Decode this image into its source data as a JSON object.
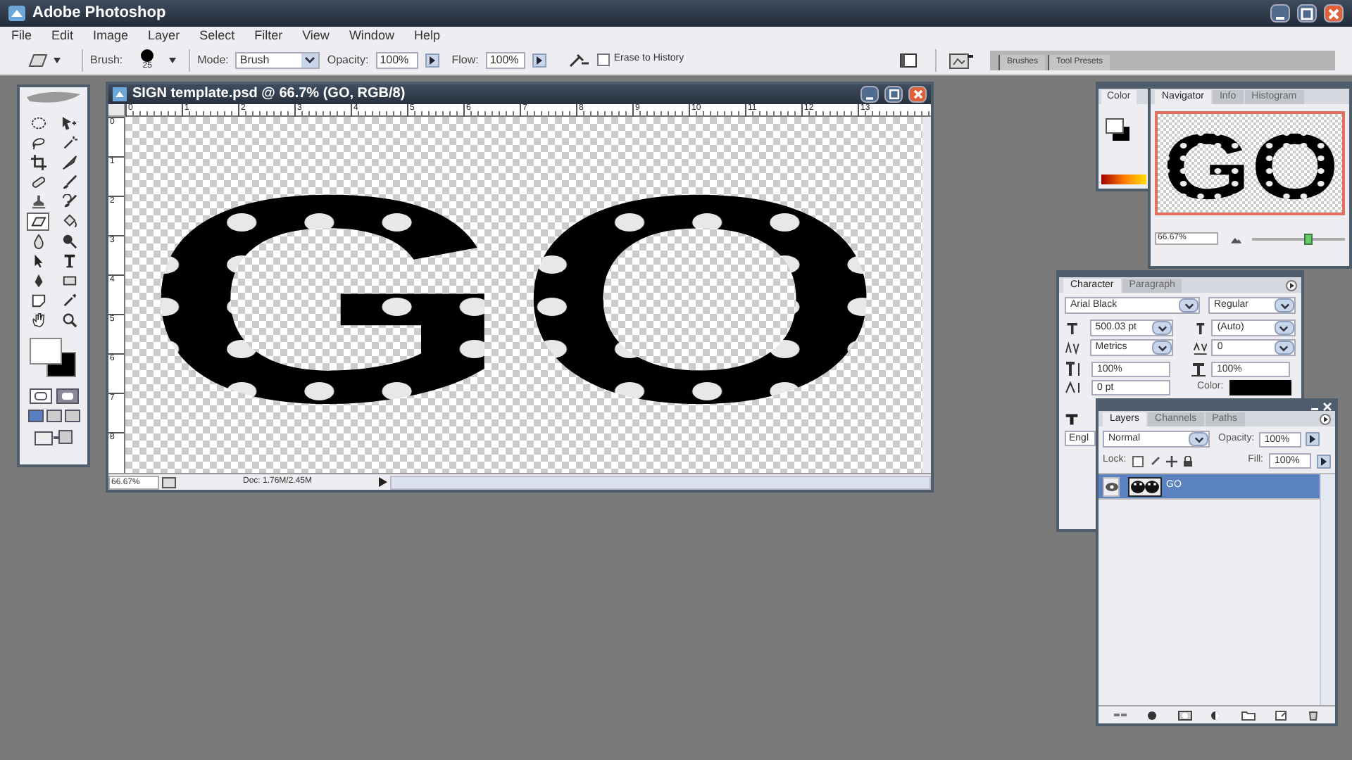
{
  "app_title": "Adobe Photoshop",
  "menu": [
    "File",
    "Edit",
    "Image",
    "Layer",
    "Select",
    "Filter",
    "View",
    "Window",
    "Help"
  ],
  "options_bar": {
    "brush_label": "Brush:",
    "brush_size": "25",
    "mode_label": "Mode:",
    "mode_value": "Brush",
    "opacity_label": "Opacity:",
    "opacity_value": "100%",
    "flow_label": "Flow:",
    "flow_value": "100%",
    "erase_to_history": {
      "label": "Erase to History",
      "checked": false
    },
    "palette_tabs": [
      "Brushes",
      "Tool Presets"
    ]
  },
  "tools": [
    {
      "kind": "marquee",
      "selected": false
    },
    {
      "kind": "move",
      "selected": false
    },
    {
      "kind": "lasso",
      "selected": false
    },
    {
      "kind": "wand",
      "selected": false
    },
    {
      "kind": "crop",
      "selected": false
    },
    {
      "kind": "slice",
      "selected": false
    },
    {
      "kind": "heal",
      "selected": false
    },
    {
      "kind": "brush",
      "selected": false
    },
    {
      "kind": "stamp",
      "selected": false
    },
    {
      "kind": "history",
      "selected": false
    },
    {
      "kind": "eraser",
      "selected": true
    },
    {
      "kind": "bucket",
      "selected": false
    },
    {
      "kind": "blur",
      "selected": false
    },
    {
      "kind": "dodge",
      "selected": false
    },
    {
      "kind": "select",
      "selected": false
    },
    {
      "kind": "type",
      "selected": false
    },
    {
      "kind": "pen",
      "selected": false
    },
    {
      "kind": "shape",
      "selected": false
    },
    {
      "kind": "notes",
      "selected": false
    },
    {
      "kind": "eyedropper",
      "selected": false
    },
    {
      "kind": "hand",
      "selected": false
    },
    {
      "kind": "zoom",
      "selected": false
    }
  ],
  "document": {
    "title": "SIGN template.psd @ 66.7% (GO, RGB/8)",
    "ruler_h": [
      "0",
      "1",
      "2",
      "3",
      "4",
      "5",
      "6",
      "7",
      "8",
      "9",
      "10",
      "11",
      "12",
      "13"
    ],
    "ruler_v": [
      "0",
      "1",
      "2",
      "3",
      "4",
      "5",
      "6",
      "7",
      "8"
    ],
    "canvas_text": "GO",
    "zoom": "66.67%",
    "doc_info": "Doc: 1.76M/2.45M"
  },
  "color_panel": {
    "tab": "Color"
  },
  "navigator": {
    "tabs": [
      {
        "label": "Navigator",
        "selected": true
      },
      {
        "label": "Info",
        "selected": false
      },
      {
        "label": "Histogram",
        "selected": false
      }
    ],
    "preview_text": "GO",
    "zoom": "66.67%",
    "level": 0.6
  },
  "character": {
    "tabs": [
      {
        "label": "Character",
        "selected": true
      },
      {
        "label": "Paragraph",
        "selected": false
      }
    ],
    "font_family": "Arial Black",
    "font_style": "Regular",
    "size": "500.03 pt",
    "leading": "(Auto)",
    "kerning": "Metrics",
    "tracking": "0",
    "vertical_scale": "100%",
    "horizontal_scale": "100%",
    "baseline_shift": "0 pt",
    "color_label": "Color:",
    "language": "Engl"
  },
  "layers": {
    "tabs": [
      {
        "label": "Layers",
        "selected": true
      },
      {
        "label": "Channels",
        "selected": false
      },
      {
        "label": "Paths",
        "selected": false
      }
    ],
    "blend_mode": "Normal",
    "opacity_label": "Opacity:",
    "opacity": "100%",
    "lock_label": "Lock:",
    "fill_label": "Fill:",
    "fill": "100%",
    "items": [
      {
        "name": "GO",
        "visible": true,
        "selected": true
      }
    ]
  }
}
